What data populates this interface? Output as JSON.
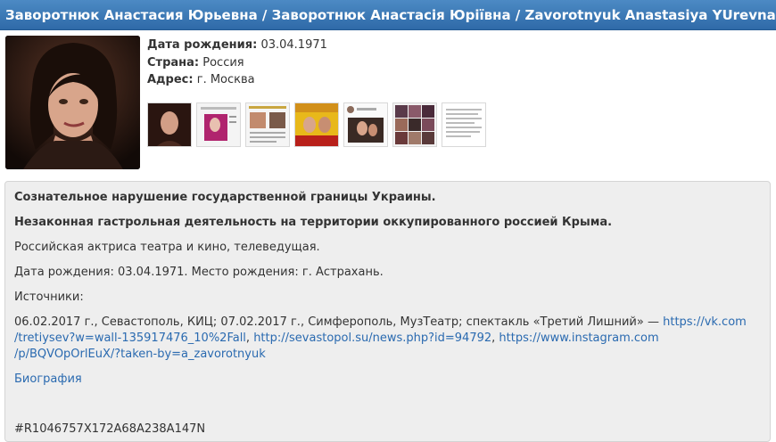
{
  "header": {
    "title": "Заворотнюк Анастасия Юрьевна / Заворотнюк Анастасія Юріївна / Zavorotnyuk Anastasiya YUrevna"
  },
  "profile": {
    "birth_label": "Дата рождения:",
    "birth_value": "03.04.1971",
    "country_label": "Страна:",
    "country_value": "Россия",
    "address_label": "Адрес:",
    "address_value": "г. Москва"
  },
  "thumbnails_count": 7,
  "content": {
    "heading1": "Сознательное нарушение государственной границы Украины.",
    "heading2": "Незаконная гастрольная деятельность на территории оккупированного россией Крыма.",
    "desc": "Российская актриса театра и кино, телеведущая.",
    "birth": "Дата рождения: 03.04.1971. Место рождения: г. Астрахань.",
    "sources_label": "Источники:",
    "source_text": "06.02.2017 г., Севастополь, КИЦ; 07.02.2017 г., Симферополь, МузТеатр; спектакль «Третий Лишний» —",
    "link1_a": "https://vk.com",
    "link1_b": "/tretiysev?w=wall-135917476_10%2Fall",
    "link2": "http://sevastopol.su/news.php?id=94792",
    "link3_a": "https://www.instagram.com",
    "link3_b": "/p/BQVOpOrlEuX/?taken-by=a_zavorotnyuk",
    "bio_link": "Биография",
    "code": "#R1046757X172A68A238A147N"
  },
  "colors": {
    "header_bg": "#3a78b8",
    "link": "#2a6ab0",
    "panel_bg": "#eeeeee"
  }
}
